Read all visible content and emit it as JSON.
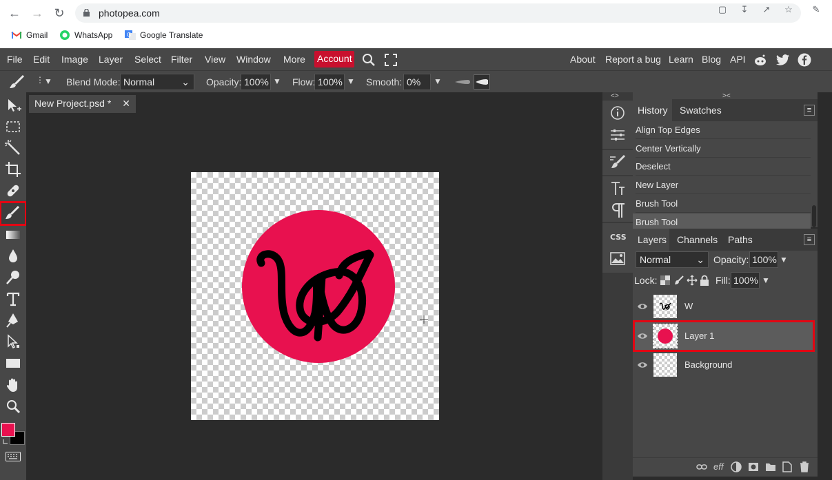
{
  "browser": {
    "url": "photopea.com",
    "bookmarks": [
      "Gmail",
      "WhatsApp",
      "Google Translate"
    ]
  },
  "menu": {
    "items": [
      "File",
      "Edit",
      "Image",
      "Layer",
      "Select",
      "Filter",
      "View",
      "Window",
      "More"
    ],
    "account": "Account",
    "right": [
      "About",
      "Report a bug",
      "Learn",
      "Blog",
      "API"
    ]
  },
  "options": {
    "blend_label": "Blend Mode:",
    "blend_value": "Normal",
    "opacity_label": "Opacity:",
    "opacity_value": "100%",
    "flow_label": "Flow:",
    "flow_value": "100%",
    "smooth_label": "Smooth:",
    "smooth_value": "0%"
  },
  "document": {
    "tab_title": "New Project.psd *",
    "close": "✕"
  },
  "colors": {
    "accent": "#c8102e",
    "foreground": "#e8114f",
    "background": "#000000",
    "circle": "#e8114f"
  },
  "history": {
    "tabs": [
      "History",
      "Swatches"
    ],
    "items": [
      "Align Top Edges",
      "Center Vertically",
      "Deselect",
      "New Layer",
      "Brush Tool",
      "Brush Tool"
    ]
  },
  "layers": {
    "tabs": [
      "Layers",
      "Channels",
      "Paths"
    ],
    "blend": "Normal",
    "opacity_label": "Opacity:",
    "opacity_value": "100%",
    "lock_label": "Lock:",
    "fill_label": "Fill:",
    "fill_value": "100%",
    "items": [
      "W",
      "Layer 1",
      "Background"
    ]
  }
}
